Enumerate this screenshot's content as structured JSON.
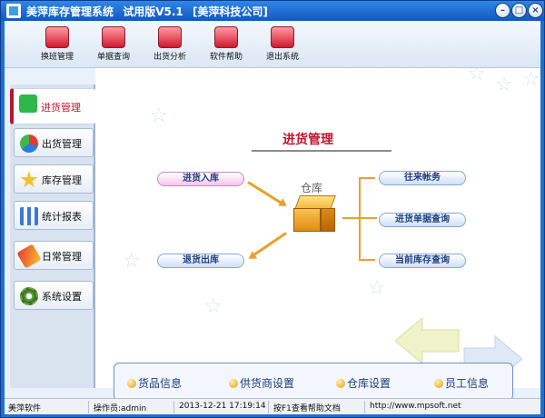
{
  "window": {
    "title_parts": [
      "美萍库存管理系统",
      "试用版V5.1",
      "[美萍科技公司]"
    ],
    "controls": [
      "–",
      "□",
      "×"
    ]
  },
  "toolbar": {
    "buttons": [
      {
        "label": "换班管理",
        "icon": "user-switch-icon"
      },
      {
        "label": "单据查询",
        "icon": "magnifier-icon"
      },
      {
        "label": "出货分析",
        "icon": "bar-chart-icon"
      },
      {
        "label": "软件帮助",
        "icon": "help-icon"
      },
      {
        "label": "退出系统",
        "icon": "power-icon"
      }
    ]
  },
  "sidebar": {
    "items": [
      {
        "label": "进货管理",
        "icon": "plus-icon",
        "active": true
      },
      {
        "label": "出货管理",
        "icon": "pie-icon"
      },
      {
        "label": "库存管理",
        "icon": "star-icon"
      },
      {
        "label": "统计报表",
        "icon": "report-icon"
      },
      {
        "label": "日常管理",
        "icon": "pen-icon"
      },
      {
        "label": "系统设置",
        "icon": "gear-icon"
      }
    ]
  },
  "main": {
    "title": "进货管理",
    "warehouse_label": "仓库",
    "left_actions": [
      "进货入库",
      "退货出库"
    ],
    "right_actions": [
      "往来帐务",
      "进货单据查询",
      "当前库存查询"
    ],
    "bottom_items": [
      "货品信息",
      "供货商设置",
      "仓库设置",
      "员工信息"
    ]
  },
  "status": {
    "app": "美萍软件",
    "operator": "操作员:admin",
    "datetime": "2013-12-21 17:19:14",
    "help": "按F1查看帮助文档",
    "url": "http://www.mpsoft.net"
  },
  "colors": {
    "accent": "#c0142a",
    "titlebar": "#1f6fd1",
    "arrow": "#e9a12b"
  }
}
